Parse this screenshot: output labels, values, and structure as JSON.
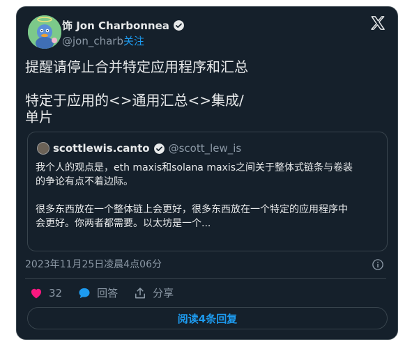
{
  "author": {
    "name": "饰 Jon Charbonnea",
    "handle": "@jon_charb",
    "follow_label": "关注",
    "verified": true
  },
  "brand_icon": "x-logo-icon",
  "tweet": {
    "lines": [
      "提醒请停止合并特定应用程序和汇总",
      "特定于应用的<>通用汇总<>集成/",
      "单片"
    ]
  },
  "quoted": {
    "name": "scottlewis.canto",
    "handle": "@scott_lew_is",
    "verified": true,
    "lines": [
      "我个人的观点是，eth maxis和solana maxis之间关于整体式链条与卷装",
      "的争论有点不着边际。",
      "很多东西放在一个整体链上会更好，很多东西放在一个特定的应用程序中",
      "会更好。你两者都需要。以太坊是一个..."
    ]
  },
  "timestamp": "2023年11月25日凌晨4点06分",
  "actions": {
    "like_count": "32",
    "reply_label": "回答",
    "share_label": "分享"
  },
  "read_replies_label": "阅读4条回复",
  "colors": {
    "background": "#15202b",
    "border": "#38444d",
    "accent": "#1d9bf0",
    "like": "#f91880",
    "text": "#e7e9ea",
    "muted": "#8b98a5"
  }
}
